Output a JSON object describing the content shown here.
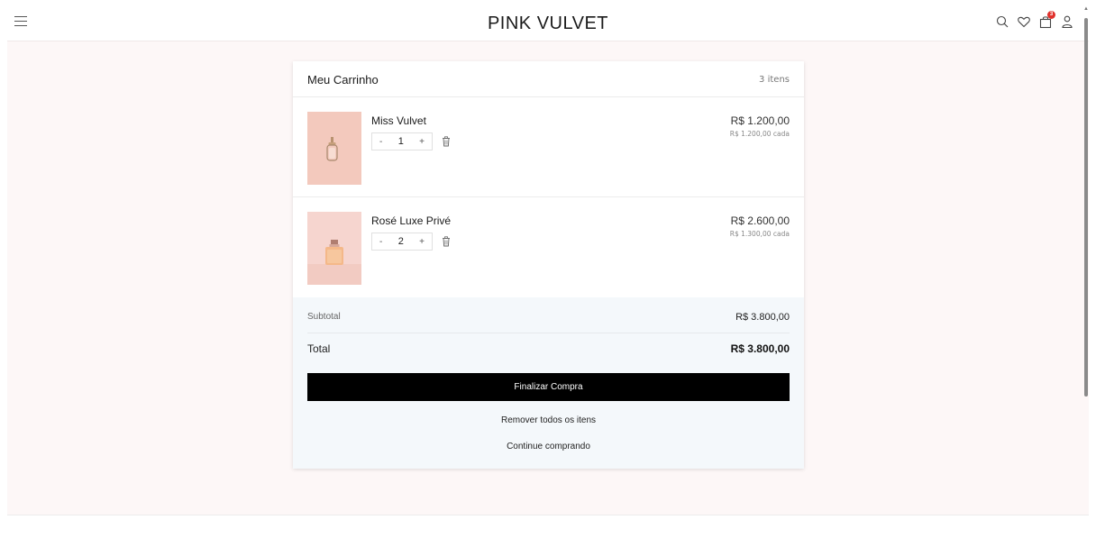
{
  "header": {
    "brand": "PINK VULVET",
    "cart_count": "3",
    "icons": [
      "menu-icon",
      "search-icon",
      "heart-icon",
      "bag-icon",
      "user-icon"
    ]
  },
  "cart": {
    "title": "Meu Carrinho",
    "item_count": "3 itens",
    "items": [
      {
        "name": "Miss Vulvet",
        "quantity": "1",
        "price": "R$ 1.200,00",
        "unit_price": "R$ 1.200,00 cada",
        "decrement": "-",
        "increment": "+"
      },
      {
        "name": "Rosé Luxe Privé",
        "quantity": "2",
        "price": "R$ 2.600,00",
        "unit_price": "R$ 1.300,00 cada",
        "decrement": "-",
        "increment": "+"
      }
    ]
  },
  "summary": {
    "subtotal_label": "Subtotal",
    "subtotal_value": "R$ 3.800,00",
    "total_label": "Total",
    "total_value": "R$ 3.800,00",
    "checkout_label": "Finalizar Compra",
    "remove_all_label": "Remover todos os itens",
    "continue_label": "Continue comprando"
  },
  "colors": {
    "page_bg": "#fdf7f7",
    "summary_bg": "#f4f8fb",
    "checkout_bg": "#000000",
    "badge": "#e0312c"
  }
}
